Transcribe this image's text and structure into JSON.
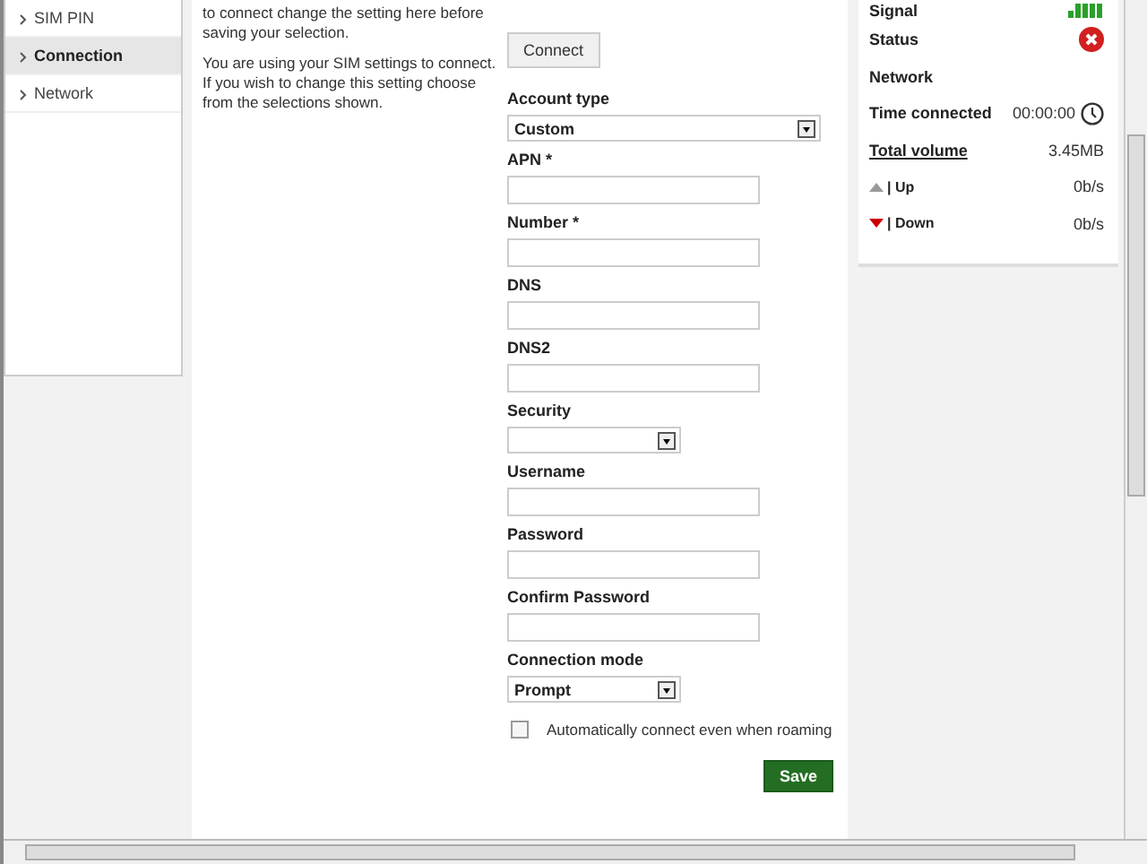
{
  "sidebar": {
    "items": [
      {
        "label": "SIM PIN",
        "selected": false
      },
      {
        "label": "Connection",
        "selected": true
      },
      {
        "label": "Network",
        "selected": false
      }
    ]
  },
  "description": [
    "to connect change the setting here before saving your selection.",
    "You are using your SIM settings to connect. If you wish to change this setting choose from the selections shown."
  ],
  "connect_button": "Connect",
  "form": {
    "fields": [
      {
        "kind": "wide-select",
        "label": "Account type",
        "value": "Custom"
      },
      {
        "kind": "text",
        "label": "APN *"
      },
      {
        "kind": "text",
        "label": "Number *"
      },
      {
        "kind": "text",
        "label": "DNS"
      },
      {
        "kind": "text",
        "label": "DNS2"
      },
      {
        "kind": "select",
        "label": "Security"
      },
      {
        "kind": "text",
        "label": "Username"
      },
      {
        "kind": "password",
        "label": "Password"
      },
      {
        "kind": "password",
        "label": "Confirm Password"
      },
      {
        "kind": "select",
        "label": "Connection mode",
        "value": "Prompt"
      }
    ],
    "roaming": {
      "label": "Automatically connect even when roaming",
      "checked": false
    },
    "save_button": "Save"
  },
  "status_panel": {
    "signal_label": "Signal",
    "rows": [
      {
        "kind": "status",
        "label": "Status"
      },
      {
        "kind": "plain",
        "label": "Network"
      },
      {
        "kind": "time",
        "label": "Time connected",
        "value": "00:00:00"
      },
      {
        "kind": "link",
        "label": "Total volume",
        "value": "3.45MB"
      },
      {
        "kind": "up",
        "label": "| Up",
        "value": "0b/s"
      },
      {
        "kind": "down",
        "label": "| Down",
        "value": "0b/s"
      }
    ]
  }
}
